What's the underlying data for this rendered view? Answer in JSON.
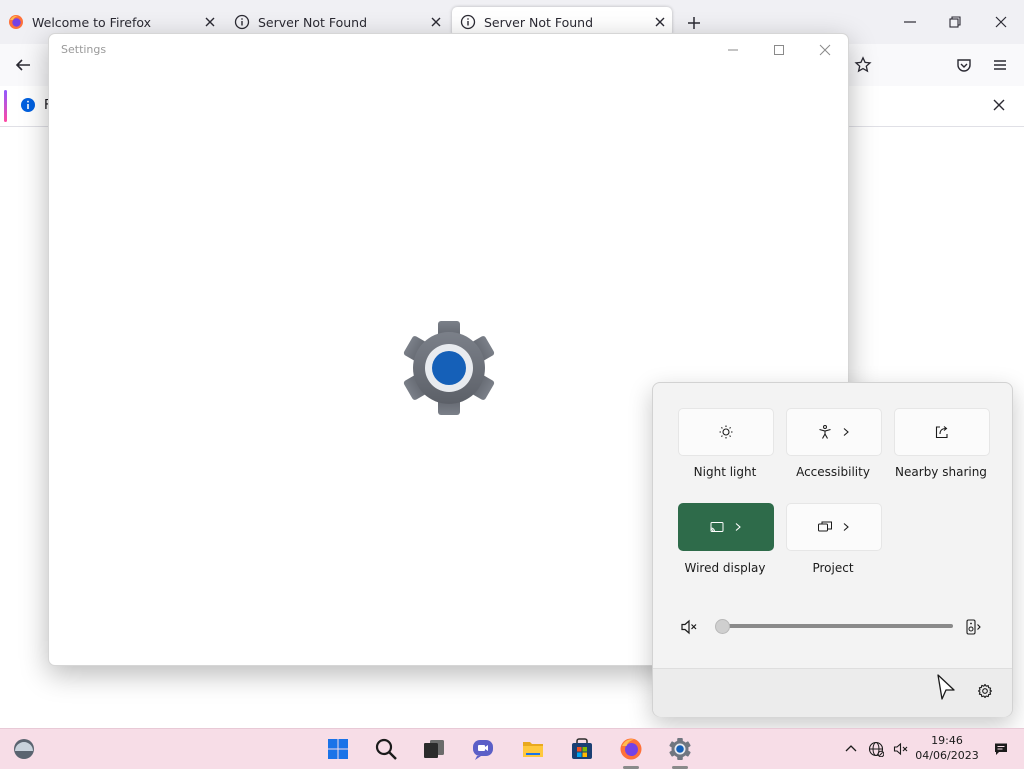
{
  "browser": {
    "tabs": [
      {
        "title": "Welcome to Firefox"
      },
      {
        "title": "Server Not Found"
      },
      {
        "title": "Server Not Found",
        "active": true
      }
    ],
    "infobar_text": "F"
  },
  "settings_window": {
    "title": "Settings"
  },
  "quick_settings": {
    "tiles": [
      {
        "label": "Night light",
        "icon": "brightness-icon",
        "active": false
      },
      {
        "label": "Accessibility",
        "icon": "accessibility-icon",
        "active": false,
        "has_chevron": true
      },
      {
        "label": "Nearby sharing",
        "icon": "share-icon",
        "active": false
      },
      {
        "label": "Wired display",
        "icon": "cast-icon",
        "active": true,
        "has_chevron": true
      },
      {
        "label": "Project",
        "icon": "project-icon",
        "active": false,
        "has_chevron": true
      }
    ],
    "volume": {
      "muted": true,
      "level": 0
    }
  },
  "taskbar": {
    "clock_time": "19:46",
    "clock_date": "04/06/2023",
    "pinned": [
      "start-icon",
      "search-icon",
      "task-view-icon",
      "chat-icon",
      "file-explorer-icon",
      "store-icon",
      "firefox-icon",
      "settings-icon"
    ]
  },
  "colors": {
    "accent_tile": "#2e6b4a",
    "taskbar": "#f7dde7"
  }
}
